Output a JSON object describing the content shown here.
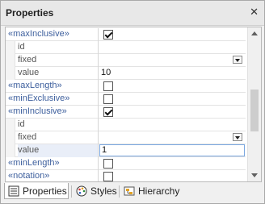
{
  "panel": {
    "title": "Properties"
  },
  "rows": [
    {
      "kind": "element",
      "label": "«maxInclusive»",
      "checkbox": true,
      "checked": true
    },
    {
      "kind": "attribute",
      "label": "id",
      "value": ""
    },
    {
      "kind": "attribute",
      "label": "fixed",
      "dropdown": true,
      "value": ""
    },
    {
      "kind": "attribute",
      "label": "value",
      "value": "10"
    },
    {
      "kind": "element",
      "label": "«maxLength»",
      "checkbox": true,
      "checked": false
    },
    {
      "kind": "element",
      "label": "«minExclusive»",
      "checkbox": true,
      "checked": false
    },
    {
      "kind": "element",
      "label": "«minInclusive»",
      "checkbox": true,
      "checked": true
    },
    {
      "kind": "attribute",
      "label": "id",
      "value": ""
    },
    {
      "kind": "attribute",
      "label": "fixed",
      "dropdown": true,
      "value": ""
    },
    {
      "kind": "attribute",
      "label": "value",
      "value": "1",
      "selected": true
    },
    {
      "kind": "element",
      "label": "«minLength»",
      "checkbox": true,
      "checked": false
    },
    {
      "kind": "element",
      "label": "«notation»",
      "checkbox": true,
      "checked": false
    }
  ],
  "tabs": [
    {
      "label": "Properties",
      "icon": "properties-icon",
      "active": true
    },
    {
      "label": "Styles",
      "icon": "palette-icon",
      "active": false
    },
    {
      "label": "Hierarchy",
      "icon": "hierarchy-icon",
      "active": false
    }
  ],
  "colors": {
    "element_label": "#3d5f9d",
    "selection_border": "#7aa7e0"
  }
}
